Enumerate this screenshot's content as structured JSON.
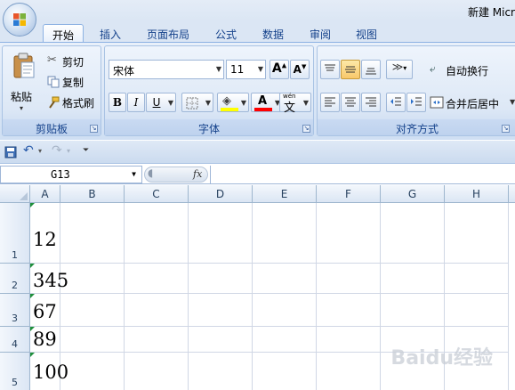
{
  "window": {
    "title": "新建 Micr"
  },
  "tabs": [
    "开始",
    "插入",
    "页面布局",
    "公式",
    "数据",
    "审阅",
    "视图"
  ],
  "active_tab": 0,
  "clipboard": {
    "paste": "粘贴",
    "cut": "剪切",
    "copy": "复制",
    "format_painter": "格式刷",
    "label": "剪贴板"
  },
  "font": {
    "name": "宋体",
    "size": "11",
    "grow": "A",
    "shrink": "A",
    "bold": "B",
    "italic": "I",
    "underline": "U",
    "phonetic_top": "wén",
    "phonetic": "文",
    "label": "字体",
    "font_color": "A"
  },
  "alignment": {
    "wrap": "自动换行",
    "merge": "合并后居中",
    "label": "对齐方式"
  },
  "formula_bar": {
    "name_box": "G13",
    "fx": "fx"
  },
  "columns": [
    "A",
    "B",
    "C",
    "D",
    "E",
    "F",
    "G",
    "H"
  ],
  "rows": [
    {
      "num": "1",
      "value": "12"
    },
    {
      "num": "2",
      "value": "345"
    },
    {
      "num": "3",
      "value": "67"
    },
    {
      "num": "4",
      "value": "89"
    },
    {
      "num": "5",
      "value": "100"
    }
  ],
  "watermark": "Baidu经验",
  "colors": {
    "accent": "#15428b",
    "ribbon": "#dbe6f4",
    "text_indicator": "#1e8f3a",
    "font_color_bar": "#ff0000",
    "highlight_bar": "#ffff00"
  }
}
